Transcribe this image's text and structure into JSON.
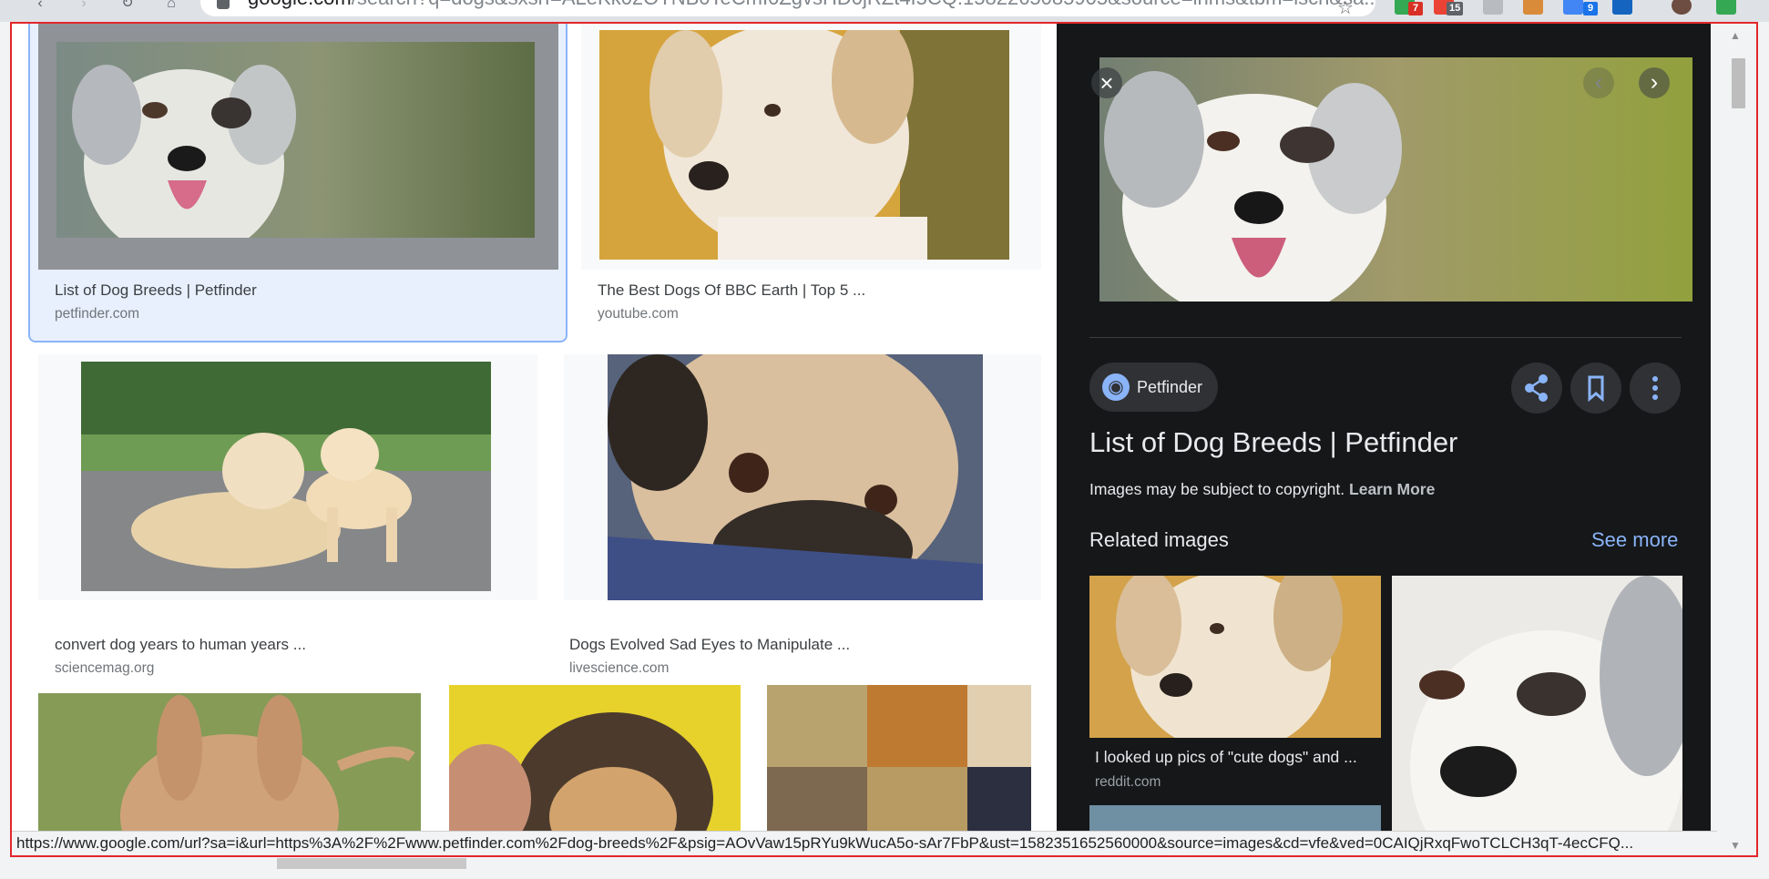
{
  "browser": {
    "url_host": "google.com",
    "url_rest": "/search?q=dogs&sxsrf=ALeKk02OTNB0TeCmI0ZgvsHD0jRZt4I5CQ:1582265085905&source=lnms&tbm=isch&sa...",
    "extension_badges": [
      "7",
      "15",
      "9"
    ]
  },
  "results": [
    {
      "title": "List of Dog Breeds | Petfinder",
      "source": "petfinder.com"
    },
    {
      "title": "The Best Dogs Of BBC Earth | Top 5 ...",
      "source": "youtube.com"
    },
    {
      "title": "convert dog years to human years ...",
      "source": "sciencemag.org"
    },
    {
      "title": "Dogs Evolved Sad Eyes to Manipulate ...",
      "source": "livescience.com"
    }
  ],
  "panel": {
    "source_name": "Petfinder",
    "title": "List of Dog Breeds | Petfinder",
    "copyright": "Images may be subject to copyright.",
    "learn_more": "Learn More",
    "related_title": "Related images",
    "see_more": "See more",
    "related": [
      {
        "caption": "I looked up pics of \"cute dogs\" and ...",
        "source": "reddit.com"
      }
    ]
  },
  "status_bar": {
    "link": "https://www.google.com/url?sa=i&url=https%3A%2F%2Fwww.petfinder.com%2Fdog-breeds%2F&psig=AOvVaw15pRYu9kWucA5o-sAr7FbP&ust=1582351652560000&source=images&cd=vfe&ved=0CAIQjRxqFwoTCLCH3qT-4ecCFQ..."
  },
  "icons": [
    "back-icon",
    "forward-icon",
    "reload-icon",
    "home-icon",
    "lock-icon",
    "star-icon",
    "close-icon",
    "chevron-left-icon",
    "chevron-right-icon",
    "globe-icon",
    "share-icon",
    "bookmark-icon",
    "more-vert-icon",
    "scroll-up-icon",
    "scroll-down-icon"
  ],
  "colors": {
    "accent_blue": "#8ab4f8",
    "panel_background": "#151719",
    "selection_background": "#e8f0fe",
    "frame_outline": "#e3262b"
  }
}
